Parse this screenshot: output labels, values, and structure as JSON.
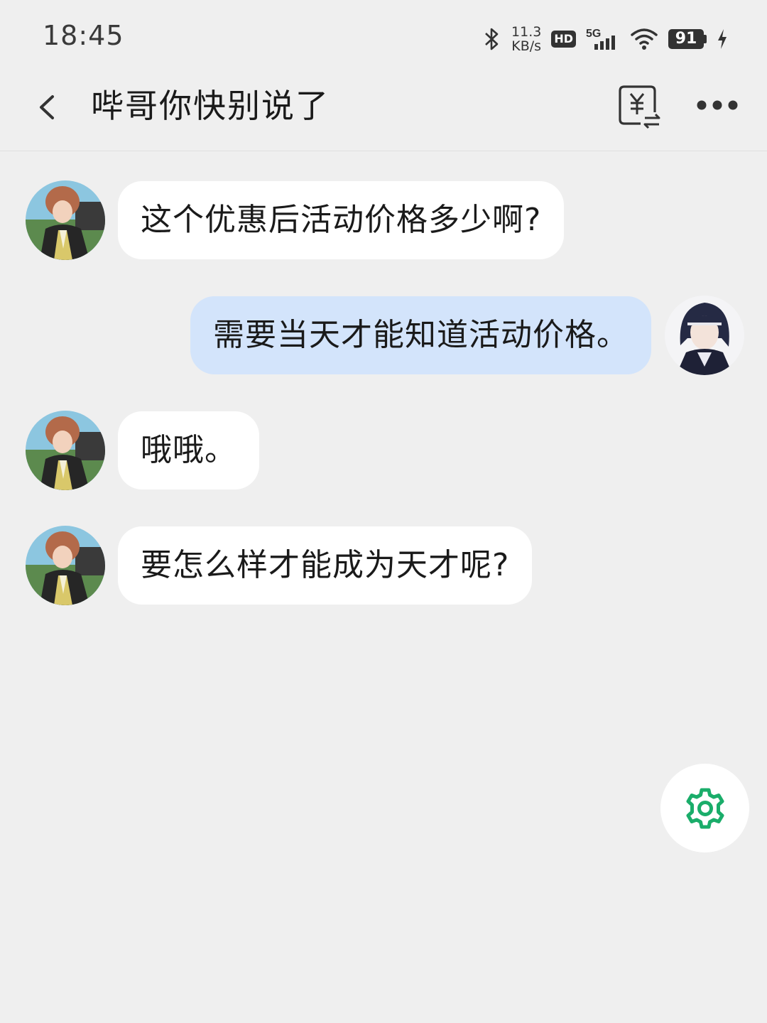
{
  "status_bar": {
    "time": "18:45",
    "net_speed_value": "11.3",
    "net_speed_unit": "KB/s",
    "hd_badge": "HD",
    "network_type": "5G",
    "battery_level": "91",
    "icons": [
      "bluetooth-icon",
      "hd-icon",
      "signal-icon",
      "wifi-icon",
      "battery-icon",
      "charging-icon"
    ]
  },
  "header": {
    "title": "哔哥你快别说了",
    "icons": [
      "back-icon",
      "yuan-transfer-icon",
      "more-icon"
    ]
  },
  "messages": [
    {
      "side": "incoming",
      "text": "这个优惠后活动价格多少啊?"
    },
    {
      "side": "outgoing",
      "text": "需要当天才能知道活动价格。"
    },
    {
      "side": "incoming",
      "text": "哦哦。"
    },
    {
      "side": "incoming",
      "text": "要怎么样才能成为天才呢?"
    }
  ],
  "fab": {
    "icon": "gear-icon"
  },
  "colors": {
    "background": "#efefef",
    "incoming_bubble": "#ffffff",
    "outgoing_bubble": "#d3e4fb",
    "accent_green": "#1aad6a"
  }
}
